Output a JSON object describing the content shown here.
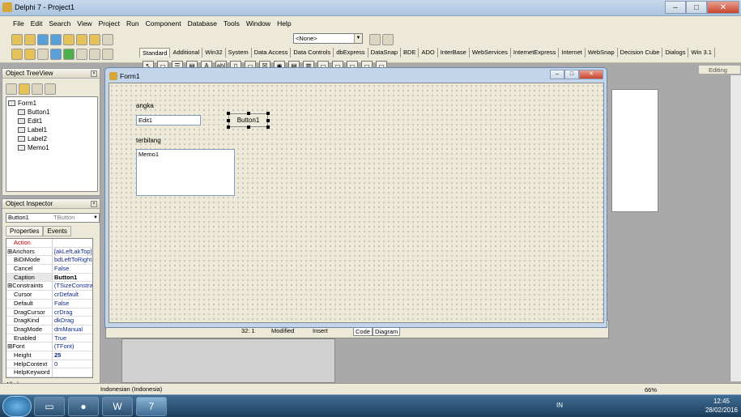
{
  "window": {
    "title": "Delphi 7 - Project1",
    "buttons": [
      "–",
      "□",
      "✕"
    ]
  },
  "menu": [
    "File",
    "Edit",
    "Search",
    "View",
    "Project",
    "Run",
    "Component",
    "Database",
    "Tools",
    "Window",
    "Help"
  ],
  "config_combo": "<None>",
  "palette_tabs": [
    "Standard",
    "Additional",
    "Win32",
    "System",
    "Data Access",
    "Data Controls",
    "dbExpress",
    "DataSnap",
    "BDE",
    "ADO",
    "InterBase",
    "WebServices",
    "InternetExpress",
    "Internet",
    "WebSnap",
    "Decision Cube",
    "Dialogs",
    "Win 3.1"
  ],
  "palette_icons": [
    "↖",
    "▭",
    "☰",
    "▤",
    "A",
    "ab|",
    "▯",
    "▭",
    "☒",
    "◉",
    "▤",
    "▥",
    "▭",
    "▭",
    "▭",
    "▭",
    "▭"
  ],
  "editing_label": "Editing",
  "tree": {
    "title": "Object TreeView",
    "items": [
      "Form1",
      "Button1",
      "Edit1",
      "Label1",
      "Label2",
      "Memo1"
    ]
  },
  "inspector": {
    "title": "Object Inspector",
    "object": "Button1",
    "type": "TButton",
    "tabs": [
      "Properties",
      "Events"
    ],
    "props": [
      {
        "k": "Action",
        "v": ""
      },
      {
        "k": "Anchors",
        "v": "[akLeft,akTop]"
      },
      {
        "k": "BiDiMode",
        "v": "bdLeftToRight"
      },
      {
        "k": "Cancel",
        "v": "False"
      },
      {
        "k": "Caption",
        "v": "Button1"
      },
      {
        "k": "Constraints",
        "v": "(TSizeConstraints)"
      },
      {
        "k": "Cursor",
        "v": "crDefault"
      },
      {
        "k": "Default",
        "v": "False"
      },
      {
        "k": "DragCursor",
        "v": "crDrag"
      },
      {
        "k": "DragKind",
        "v": "dkDrag"
      },
      {
        "k": "DragMode",
        "v": "dmManual"
      },
      {
        "k": "Enabled",
        "v": "True"
      },
      {
        "k": "Font",
        "v": "(TFont)"
      },
      {
        "k": "Height",
        "v": "25"
      },
      {
        "k": "HelpContext",
        "v": "0"
      },
      {
        "k": "HelpKeyword",
        "v": ""
      }
    ],
    "all_shown": "All shown"
  },
  "form": {
    "title": "Form1",
    "label1": "angka",
    "edit1": "Edit1",
    "button1": "Button1",
    "label2": "terbilang",
    "memo1": "Memo1"
  },
  "code_status": {
    "pos": "32: 1",
    "state": "Modified",
    "mode": "Insert",
    "tabs": [
      "Code",
      "Diagram"
    ]
  },
  "statusbar": {
    "language": "Indonesian (Indonesia)",
    "zoom": "66%"
  },
  "taskbar": {
    "lang": "IN",
    "time": "12:45",
    "date": "28/02/2016"
  }
}
